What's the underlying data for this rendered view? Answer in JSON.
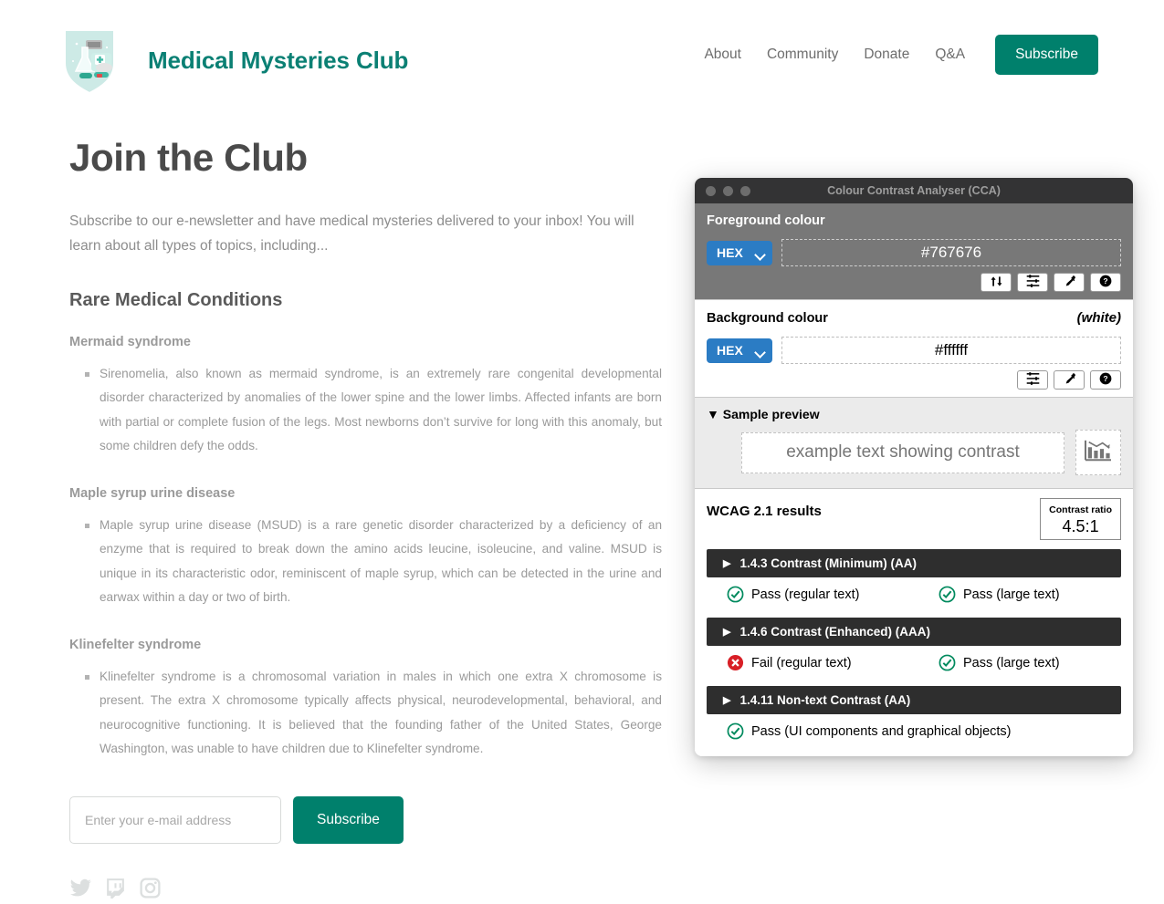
{
  "site": {
    "brand_name": "Medical Mysteries Club",
    "logo_icon": "medical-shield-logo",
    "nav": [
      {
        "label": "About",
        "name": "about"
      },
      {
        "label": "Community",
        "name": "community"
      },
      {
        "label": "Donate",
        "name": "donate"
      },
      {
        "label": "Q&A",
        "name": "qa"
      }
    ],
    "nav_subscribe_label": "Subscribe",
    "accent_color": "#00806c",
    "brand_color": "#0b8074"
  },
  "main": {
    "page_title": "Join the Club",
    "intro": "Subscribe to our e-newsletter and have medical mysteries delivered to your inbox! You will learn about all types of topics, including...",
    "section_title": "Rare Medical Conditions",
    "conditions": [
      {
        "title": "Mermaid syndrome",
        "body": "Sirenomelia, also known as mermaid syndrome, is an extremely rare congenital developmental disorder characterized by anomalies of the lower spine and the lower limbs. Affected infants are born with partial or complete fusion of the legs. Most newborns don’t survive for long with this anomaly, but some children defy the odds."
      },
      {
        "title": "Maple syrup urine disease",
        "body": "Maple syrup urine disease (MSUD) is a rare genetic disorder characterized by a deficiency of an enzyme that is required to break down the amino acids leucine, isoleucine, and valine. MSUD is unique in its characteristic odor, reminiscent of maple syrup, which can be detected in the urine and earwax within a day or two of birth."
      },
      {
        "title": "Klinefelter syndrome",
        "body": "Klinefelter syndrome is a chromosomal variation in males in which one extra X chromosome is present. The extra X chromosome typically affects physical, neurodevelopmental, behavioral, and neurocognitive functioning. It is believed that the founding father of the United States, George Washington, was unable to have children due to Klinefelter syndrome."
      }
    ],
    "form": {
      "email_placeholder": "Enter your e-mail address",
      "email_value": "",
      "submit_label": "Subscribe"
    },
    "social": [
      {
        "name": "twitter-icon"
      },
      {
        "name": "twitch-icon"
      },
      {
        "name": "instagram-icon"
      }
    ]
  },
  "cca": {
    "window_title": "Colour Contrast Analyser (CCA)",
    "foreground": {
      "label": "Foreground colour",
      "format": "HEX",
      "value": "#767676",
      "buttons": [
        {
          "name": "swap-colours-button",
          "icon": "up-down-arrows-icon"
        },
        {
          "name": "colour-sliders-button",
          "icon": "sliders-icon"
        },
        {
          "name": "eyedropper-button",
          "icon": "eyedropper-icon"
        },
        {
          "name": "help-button",
          "icon": "help-icon"
        }
      ]
    },
    "background": {
      "label": "Background colour",
      "note": "(white)",
      "format": "HEX",
      "value": "#ffffff",
      "buttons": [
        {
          "name": "colour-sliders-button",
          "icon": "sliders-icon"
        },
        {
          "name": "eyedropper-button",
          "icon": "eyedropper-icon"
        },
        {
          "name": "help-button",
          "icon": "help-icon"
        }
      ]
    },
    "preview": {
      "label": "Sample preview",
      "disclosure": "▼",
      "sample_text": "example text showing contrast",
      "graphic_icon": "declining-bar-chart-icon"
    },
    "results": {
      "title": "WCAG 2.1 results",
      "ratio_label": "Contrast ratio",
      "ratio_value": "4.5:1",
      "criteria": [
        {
          "name": "1-4-3-contrast-minimum",
          "heading": "1.4.3 Contrast (Minimum) (AA)",
          "disclosure": "▶",
          "outcomes": [
            {
              "status": "pass",
              "text": "Pass (regular text)"
            },
            {
              "status": "pass",
              "text": "Pass (large text)"
            }
          ]
        },
        {
          "name": "1-4-6-contrast-enhanced",
          "heading": "1.4.6 Contrast (Enhanced) (AAA)",
          "disclosure": "▶",
          "outcomes": [
            {
              "status": "fail",
              "text": "Fail (regular text)"
            },
            {
              "status": "pass",
              "text": "Pass (large text)"
            }
          ]
        },
        {
          "name": "1-4-11-non-text-contrast",
          "heading": "1.4.11 Non-text Contrast (AA)",
          "disclosure": "▶",
          "outcomes": [
            {
              "status": "pass",
              "text": "Pass (UI components and graphical objects)"
            }
          ]
        }
      ],
      "pass_color": "#008a5e",
      "fail_color": "#d81f26"
    }
  }
}
